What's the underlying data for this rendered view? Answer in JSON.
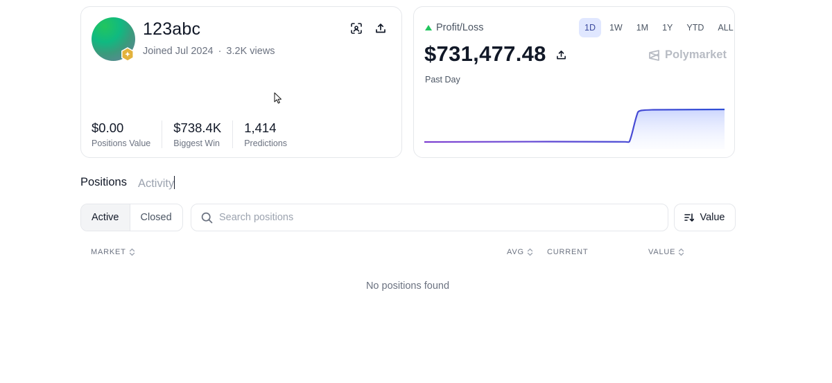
{
  "profile": {
    "username": "123abc",
    "joined": "Joined Jul 2024",
    "views": "3.2K views",
    "stats": [
      {
        "value": "$0.00",
        "label": "Positions Value"
      },
      {
        "value": "$738.4K",
        "label": "Biggest Win"
      },
      {
        "value": "1,414",
        "label": "Predictions"
      }
    ]
  },
  "pnl": {
    "title": "Profit/Loss",
    "amount": "$731,477.48",
    "period": "Past Day",
    "brand": "Polymarket",
    "ranges": [
      "1D",
      "1W",
      "1M",
      "1Y",
      "YTD",
      "ALL"
    ],
    "active_range": "1D",
    "colors": {
      "line_start": "#7e3fd1",
      "line_end": "#2f4fd6",
      "fill": "#c7d2fe",
      "up": "#22c55e"
    }
  },
  "tabs": [
    {
      "label": "Positions",
      "active": true
    },
    {
      "label": "Activity",
      "active": false
    }
  ],
  "filters": {
    "segments": [
      {
        "label": "Active",
        "active": true
      },
      {
        "label": "Closed",
        "active": false
      }
    ],
    "search_placeholder": "Search positions",
    "sort_label": "Value"
  },
  "table": {
    "columns": {
      "market": "MARKET",
      "avg": "AVG",
      "current": "CURRENT",
      "value": "VALUE"
    },
    "empty_message": "No positions found"
  },
  "icons": [
    "verified-badge-icon",
    "qr-scan-icon",
    "share-icon",
    "triangle-up-icon",
    "polymarket-logo-icon",
    "search-icon",
    "sort-icon",
    "sort-arrows-icon"
  ]
}
